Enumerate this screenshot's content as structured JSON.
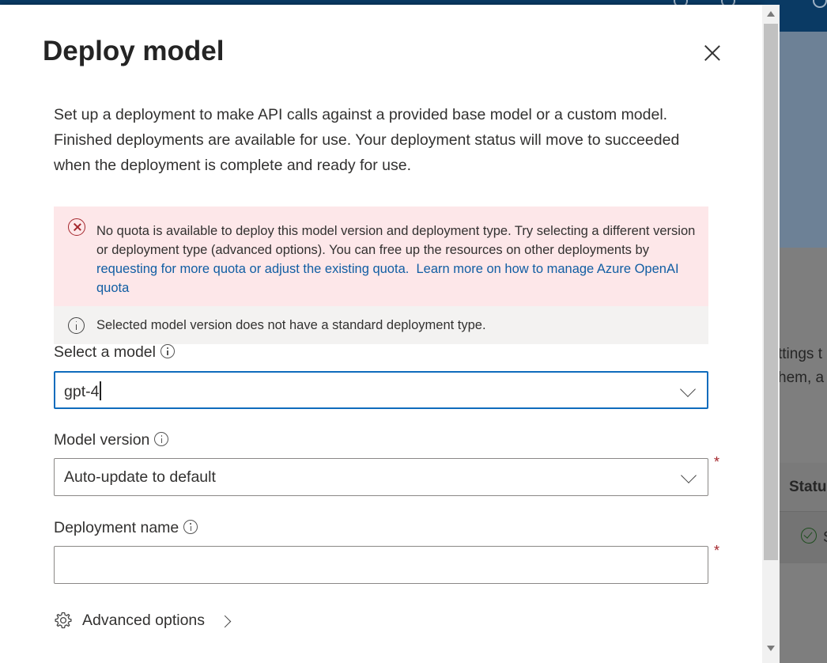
{
  "dialog": {
    "title": "Deploy model",
    "intro": "Set up a deployment to make API calls against a provided base model or a custom model. Finished deployments are available for use. Your deployment status will move to succeeded when the deployment is complete and ready for use.",
    "error": {
      "text": "No quota is available to deploy this model version and deployment type. Try selecting a different version or deployment type (advanced options). You can free up the resources on other deployments by ",
      "link1": "requesting for more quota or adjust the existing quota.",
      "link2": "Learn more on how to manage Azure OpenAI quota"
    },
    "info_message": "Selected model version does not have a standard deployment type.",
    "select_model": {
      "label": "Select a model",
      "value": "gpt-4"
    },
    "model_version": {
      "label": "Model version",
      "value": "Auto-update to default",
      "required_mark": "*"
    },
    "deployment_name": {
      "label": "Deployment name",
      "value": "",
      "required_mark": "*"
    },
    "advanced_options": "Advanced options"
  },
  "background": {
    "text1": "ttings t",
    "text2": "hem, a",
    "status_header": "Statu",
    "row_text": "S"
  },
  "colors": {
    "error_bg": "#fde7e9",
    "info_bg": "#f3f2f1",
    "link": "#115ea3",
    "focus": "#0f6cbd",
    "required": "#a4262c"
  }
}
